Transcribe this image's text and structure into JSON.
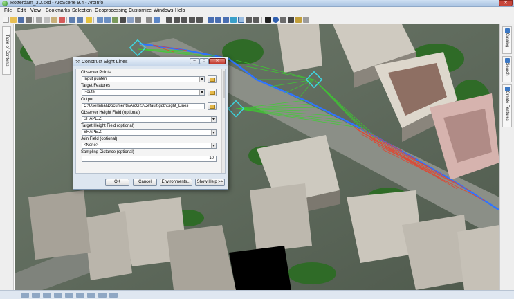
{
  "window": {
    "title": "Rotterdam_3D.sxd - ArcScene 9.4 - ArcInfo",
    "close_glyph": "✕"
  },
  "menu": {
    "items": [
      "File",
      "Edit",
      "View",
      "Bookmarks",
      "Selection",
      "Geoprocessing",
      "Customize",
      "Windows",
      "Help"
    ]
  },
  "left_dock": {
    "tab_label": "Table of Contents"
  },
  "right_dock": {
    "tabs": [
      "Catalog",
      "Search",
      "Create Features"
    ]
  },
  "dialog": {
    "title": "Construct Sight Lines",
    "title_icon": "hammer-icon",
    "min_glyph": "–",
    "max_glyph": "□",
    "close_glyph": "✕",
    "fields": {
      "observer_points_label": "Observer Points",
      "observer_points_value": "Input punten",
      "target_features_label": "Target Features",
      "target_features_value": "Route",
      "output_label": "Output",
      "output_value": "C:\\Users\\bal\\Documents\\ArcGIS\\Default.gdb\\Sight_Lines",
      "observer_height_label": "Observer Height Field (optional)",
      "observer_height_value": "SHAPE.Z",
      "target_height_label": "Target Height Field (optional)",
      "target_height_value": "SHAPE.Z",
      "join_field_label": "Join Field (optional)",
      "join_field_value": "<None>",
      "sampling_distance_label": "Sampling Distance (optional)",
      "sampling_distance_value": "10"
    },
    "buttons": {
      "ok": "OK",
      "cancel": "Cancel",
      "environments": "Environments...",
      "show_help": "Show Help >>"
    }
  },
  "colors": {
    "sight_line_visible": "#3bd12e",
    "sight_line_blocked": "#e8402a",
    "route_line": "#2f74ff",
    "observer_marker": "#3fd6e0"
  }
}
